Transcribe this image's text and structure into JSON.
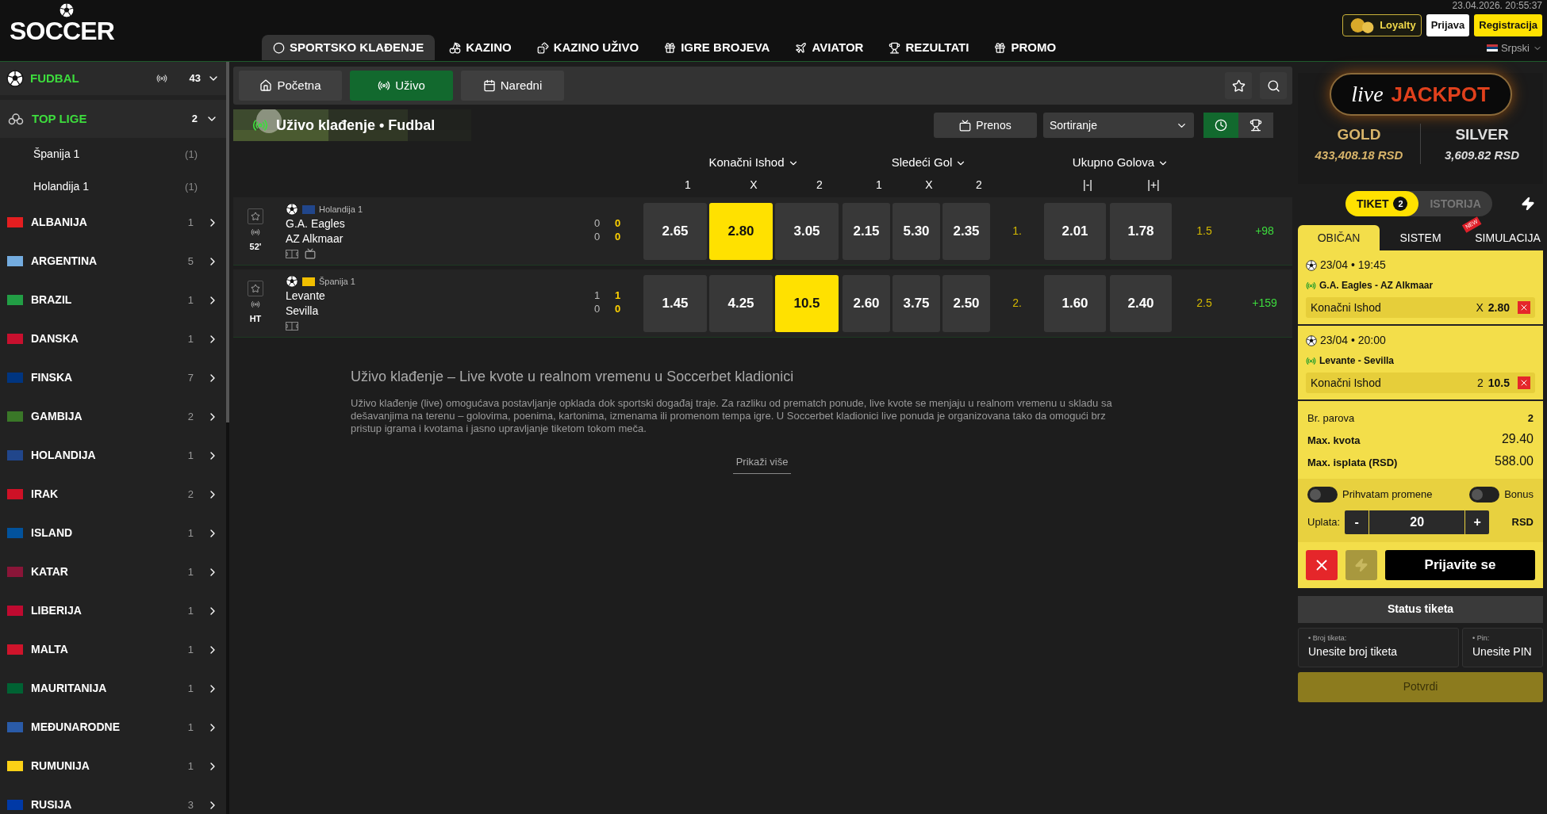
{
  "header": {
    "logo": "SOCCER",
    "datetime": "23.04.2026. 20:55:37",
    "loyalty": "Loyalty",
    "login": "Prijava",
    "register": "Registracija",
    "language": "Srpski",
    "nav": [
      {
        "label": "SPORTSKO KLAĐENJE",
        "selected": true
      },
      {
        "label": "KAZINO",
        "selected": false
      },
      {
        "label": "KAZINO UŽIVO",
        "selected": false
      },
      {
        "label": "IGRE BROJEVA",
        "selected": false
      },
      {
        "label": "AVIATOR",
        "selected": false
      },
      {
        "label": "REZULTATI",
        "selected": false
      },
      {
        "label": "PROMO",
        "selected": false
      }
    ]
  },
  "sidebar": {
    "sport": {
      "name": "FUDBAL",
      "count": "43",
      "expanded": true
    },
    "top_leagues": {
      "name": "TOP LIGE",
      "count": "2",
      "expanded": true,
      "children": [
        {
          "name": "Španija 1",
          "count": "(1)"
        },
        {
          "name": "Holandija 1",
          "count": "(1)"
        }
      ]
    },
    "countries": [
      {
        "name": "ALBANIJA",
        "count": "1",
        "color": "#e41e20"
      },
      {
        "name": "ARGENTINA",
        "count": "5",
        "color": "#74acdf"
      },
      {
        "name": "BRAZIL",
        "count": "1",
        "color": "#229e45"
      },
      {
        "name": "DANSKA",
        "count": "1",
        "color": "#c8102e"
      },
      {
        "name": "FINSKA",
        "count": "7",
        "color": "#003580"
      },
      {
        "name": "GAMBIJA",
        "count": "2",
        "color": "#3a7728"
      },
      {
        "name": "HOLANDIJA",
        "count": "1",
        "color": "#21468b"
      },
      {
        "name": "IRAK",
        "count": "2",
        "color": "#ce1126"
      },
      {
        "name": "ISLAND",
        "count": "1",
        "color": "#02529c"
      },
      {
        "name": "KATAR",
        "count": "1",
        "color": "#8a1538"
      },
      {
        "name": "LIBERIJA",
        "count": "1",
        "color": "#bf0a30"
      },
      {
        "name": "MALTA",
        "count": "1",
        "color": "#cf142b"
      },
      {
        "name": "MAURITANIJA",
        "count": "1",
        "color": "#006233"
      },
      {
        "name": "MEĐUNARODNE",
        "count": "1",
        "color": "#2a5ba8"
      },
      {
        "name": "RUMUNIJA",
        "count": "1",
        "color": "#fcd116"
      },
      {
        "name": "RUSIJA",
        "count": "3",
        "color": "#0039a6"
      }
    ]
  },
  "toolbar": {
    "tabs": [
      {
        "label": "Početna",
        "selected": false
      },
      {
        "label": "Uživo",
        "selected": true
      },
      {
        "label": "Naredni",
        "selected": false
      }
    ]
  },
  "title_bar": {
    "title": "Uživo klađenje • Fudbal",
    "stream": "Prenos",
    "sort": "Sortiranje",
    "views": [
      {
        "kind": "clock",
        "selected": true
      },
      {
        "kind": "trophy",
        "selected": false
      }
    ]
  },
  "markets": [
    {
      "title": "Konačni Ishod",
      "outcomes": [
        "1",
        "X",
        "2"
      ]
    },
    {
      "title": "Sledeći Gol",
      "outcomes": [
        "1",
        "X",
        "2"
      ]
    },
    {
      "title": "Ukupno Golova",
      "outcomes": [
        "|-|",
        "|+|"
      ]
    }
  ],
  "matches": [
    {
      "league": "Holandija 1",
      "color": "#21468b",
      "time": "52'",
      "home": "G.A. Eagles",
      "away": "AZ Alkmaar",
      "period_score": [
        "0",
        "0"
      ],
      "score": [
        "0",
        "0"
      ],
      "stream": true,
      "final": [
        {
          "value": "2.65",
          "selected": false
        },
        {
          "value": "2.80",
          "selected": true
        },
        {
          "value": "3.05",
          "selected": false
        }
      ],
      "next_goal_label": "1.",
      "next_goal": [
        {
          "value": "2.15",
          "selected": false
        },
        {
          "value": "5.30",
          "selected": false
        },
        {
          "value": "2.35",
          "selected": false
        }
      ],
      "totals": [
        {
          "value": "2.01",
          "selected": false
        },
        {
          "value": "1.78",
          "selected": false
        }
      ],
      "total_line": "1.5",
      "more": "+98"
    },
    {
      "league": "Španija 1",
      "color": "#f1bf00",
      "time": "HT",
      "home": "Levante",
      "away": "Sevilla",
      "period_score": [
        "1",
        "0"
      ],
      "score": [
        "1",
        "0"
      ],
      "stream": false,
      "final": [
        {
          "value": "1.45",
          "selected": false
        },
        {
          "value": "4.25",
          "selected": false
        },
        {
          "value": "10.5",
          "selected": true
        }
      ],
      "next_goal_label": "2.",
      "next_goal": [
        {
          "value": "2.60",
          "selected": false
        },
        {
          "value": "3.75",
          "selected": false
        },
        {
          "value": "2.50",
          "selected": false
        }
      ],
      "totals": [
        {
          "value": "1.60",
          "selected": false
        },
        {
          "value": "2.40",
          "selected": false
        }
      ],
      "total_line": "2.5",
      "more": "+159"
    }
  ],
  "info": {
    "heading": "Uživo klađenje – Live kvote u realnom vremenu u Soccerbet kladionici",
    "paragraph": "Uživo klađenje (live) omogućava postavljanje opklada dok sportski događaj traje. Za razliku od prematch ponude, live kvote se menjaju u realnom vremenu u skladu sa dešavanjima na terenu – golovima, poenima, kartonima, izmenama ili promenom tempa igre. U Soccerbet kladionici live ponuda je organizovana tako da omogući brz pristup igrama i kvotama i jasno upravljanje tiketom tokom meča.",
    "more": "Prikaži više"
  },
  "jackpot": {
    "live": "live",
    "title": "JACKPOT",
    "gold_label": "GOLD",
    "gold_amount": "433,408.18 RSD",
    "silver_label": "SILVER",
    "silver_amount": "3,609.82 RSD"
  },
  "ticket": {
    "tabs": [
      {
        "label": "TIKET",
        "badge": "2",
        "selected": true
      },
      {
        "label": "ISTORIJA",
        "selected": false
      }
    ],
    "types": [
      {
        "label": "OBIČAN",
        "selected": true
      },
      {
        "label": "SISTEM",
        "selected": false
      },
      {
        "label": "SIMULACIJA",
        "badge": "NEW",
        "selected": false
      }
    ],
    "selections": [
      {
        "datetime": "23/04 • 19:45",
        "match": "G.A. Eagles - AZ Alkmaar",
        "market": "Konačni Ishod",
        "pick": "X",
        "odd": "2.80"
      },
      {
        "datetime": "23/04 • 20:00",
        "match": "Levante - Sevilla",
        "market": "Konačni Ishod",
        "pick": "2",
        "odd": "10.5"
      }
    ],
    "pairs_label": "Br. parova",
    "pairs": "2",
    "max_odd_label": "Max. kvota",
    "max_odd": "29.40",
    "max_payout_label": "Max. isplata (RSD)",
    "max_payout": "588.00",
    "toggles": [
      {
        "label": "Prihvatam promene",
        "on": false
      },
      {
        "label": "Bonus",
        "on": false
      }
    ],
    "stake_label": "Uplata:",
    "minus": "-",
    "stake": "20",
    "plus": "+",
    "currency": "RSD",
    "submit": "Prijavite se"
  },
  "status": {
    "title": "Status tiketa",
    "fields": [
      {
        "label": "• Broj tiketa:",
        "placeholder": "Unesite broj tiketa"
      },
      {
        "label": "• Pin:",
        "placeholder": "Unesite PIN"
      }
    ],
    "confirm": "Potvrdi"
  }
}
